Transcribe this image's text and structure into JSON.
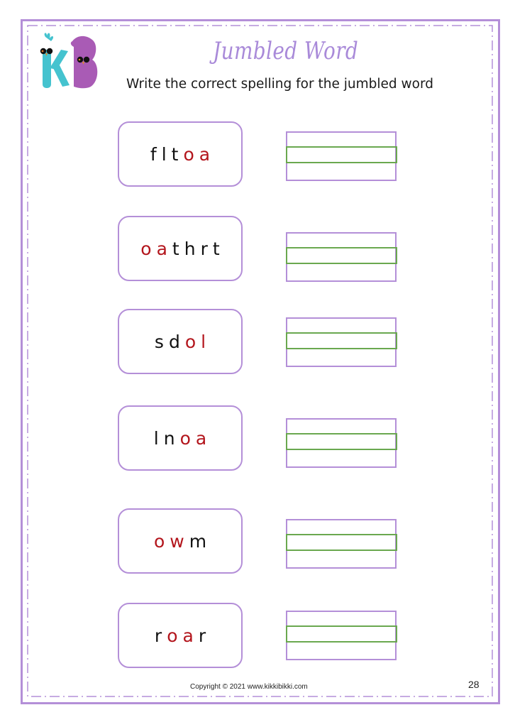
{
  "header": {
    "logo_label": "KB",
    "title": "Jumbled Word",
    "instruction": "Write the correct spelling for the jumbled word"
  },
  "colors": {
    "border": "#b48fd8",
    "title": "#a98ad9",
    "highlight_letters": "#b3151c",
    "plain_letters": "#111111",
    "writing_guide": "#6aa84f",
    "logo_k": "#45c3cf",
    "logo_b": "#a95bb5"
  },
  "items": [
    {
      "letters": [
        {
          "ch": "f",
          "hl": false
        },
        {
          "ch": "l",
          "hl": false
        },
        {
          "ch": "t",
          "hl": false
        },
        {
          "ch": "o",
          "hl": true
        },
        {
          "ch": "a",
          "hl": true
        }
      ],
      "answer": ""
    },
    {
      "letters": [
        {
          "ch": "o",
          "hl": true
        },
        {
          "ch": "a",
          "hl": true
        },
        {
          "ch": "t",
          "hl": false
        },
        {
          "ch": "h",
          "hl": false
        },
        {
          "ch": "r",
          "hl": false
        },
        {
          "ch": "t",
          "hl": false
        }
      ],
      "answer": ""
    },
    {
      "letters": [
        {
          "ch": "s",
          "hl": false
        },
        {
          "ch": "d",
          "hl": false
        },
        {
          "ch": "o",
          "hl": true
        },
        {
          "ch": "l",
          "hl": true
        }
      ],
      "answer": ""
    },
    {
      "letters": [
        {
          "ch": "l",
          "hl": false
        },
        {
          "ch": "n",
          "hl": false
        },
        {
          "ch": "o",
          "hl": true
        },
        {
          "ch": "a",
          "hl": true
        }
      ],
      "answer": ""
    },
    {
      "letters": [
        {
          "ch": "o",
          "hl": true
        },
        {
          "ch": "w",
          "hl": true
        },
        {
          "ch": "m",
          "hl": false
        }
      ],
      "answer": ""
    },
    {
      "letters": [
        {
          "ch": "r",
          "hl": false
        },
        {
          "ch": "o",
          "hl": true
        },
        {
          "ch": "a",
          "hl": true
        },
        {
          "ch": "r",
          "hl": false
        }
      ],
      "answer": ""
    }
  ],
  "footer": {
    "copyright": "Copyright © 2021 www.kikkibikki.com",
    "page_number": "28"
  }
}
